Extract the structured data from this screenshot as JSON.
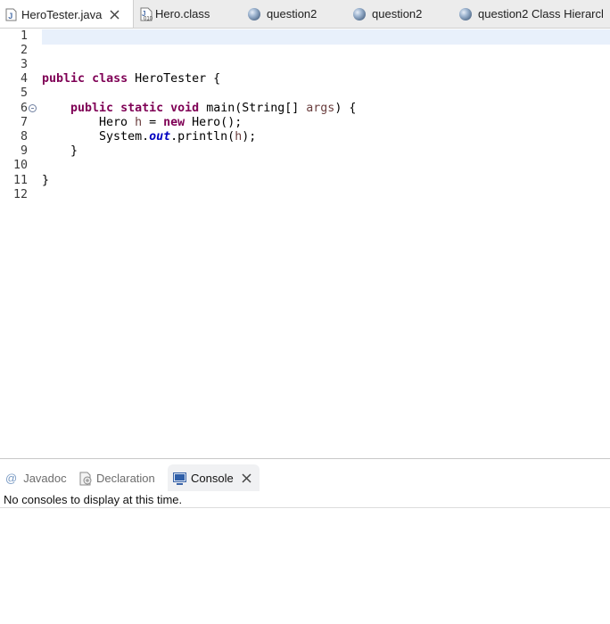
{
  "editor_tabs": [
    {
      "label": "HeroTester.java",
      "icon": "java-file-icon",
      "active": true,
      "closable": true
    },
    {
      "label": "Hero.class",
      "icon": "class-file-icon",
      "active": false
    },
    {
      "label": "question2",
      "icon": "globe-icon",
      "active": false
    },
    {
      "label": "question2",
      "icon": "globe-icon",
      "active": false
    },
    {
      "label": "question2 Class Hierarcl",
      "icon": "globe-icon",
      "active": false
    }
  ],
  "editor": {
    "line_numbers": [
      "1",
      "2",
      "3",
      "4",
      "5",
      "6",
      "7",
      "8",
      "9",
      "10",
      "11",
      "12"
    ],
    "current_line": 1,
    "lines": [
      {
        "n": "1",
        "tokens": []
      },
      {
        "n": "2",
        "tokens": []
      },
      {
        "n": "3",
        "tokens": []
      },
      {
        "n": "4",
        "tokens": [
          [
            "kw",
            "public"
          ],
          [
            "t",
            " "
          ],
          [
            "kw",
            "class"
          ],
          [
            "t",
            " HeroTester {"
          ]
        ]
      },
      {
        "n": "5",
        "tokens": []
      },
      {
        "n": "6",
        "fold": true,
        "tokens": [
          [
            "t",
            "    "
          ],
          [
            "kw",
            "public"
          ],
          [
            "t",
            " "
          ],
          [
            "kw",
            "static"
          ],
          [
            "t",
            " "
          ],
          [
            "kw",
            "void"
          ],
          [
            "t",
            " main(String[] "
          ],
          [
            "var",
            "args"
          ],
          [
            "t",
            ") {"
          ]
        ]
      },
      {
        "n": "7",
        "tokens": [
          [
            "t",
            "        Hero "
          ],
          [
            "var",
            "h"
          ],
          [
            "t",
            " = "
          ],
          [
            "kw",
            "new"
          ],
          [
            "t",
            " Hero();"
          ]
        ]
      },
      {
        "n": "8",
        "tokens": [
          [
            "t",
            "        System."
          ],
          [
            "fld",
            "out"
          ],
          [
            "t",
            ".println("
          ],
          [
            "var",
            "h"
          ],
          [
            "t",
            ");"
          ]
        ]
      },
      {
        "n": "9",
        "tokens": [
          [
            "t",
            "    }"
          ]
        ]
      },
      {
        "n": "10",
        "tokens": []
      },
      {
        "n": "11",
        "tokens": [
          [
            "t",
            "}"
          ]
        ]
      },
      {
        "n": "12",
        "tokens": []
      }
    ]
  },
  "bottom_tabs": [
    {
      "label": "Javadoc",
      "icon": "at-icon",
      "active": false
    },
    {
      "label": "Declaration",
      "icon": "declaration-icon",
      "active": false
    },
    {
      "label": "Console",
      "icon": "console-icon",
      "active": true,
      "closable": true
    }
  ],
  "console": {
    "message": "No consoles to display at this time."
  },
  "colors": {
    "keyword": "#7f0055",
    "variable": "#6a3e3e",
    "static_field": "#0000c0",
    "current_line": "#e8f0fb"
  }
}
